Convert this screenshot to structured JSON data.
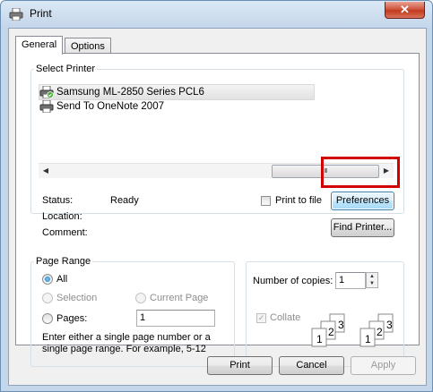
{
  "window": {
    "title": "Print",
    "close_glyph": "✕",
    "icon": "printer-icon"
  },
  "tabs": [
    {
      "label": "General",
      "active": true
    },
    {
      "label": "Options",
      "active": false
    }
  ],
  "select_printer": {
    "group_label": "Select Printer",
    "printers": [
      {
        "name": "Samsung ML-2850 Series PCL6",
        "selected": true,
        "default": true
      },
      {
        "name": "Send To OneNote 2007",
        "selected": false
      }
    ],
    "scroll": {
      "left_arrow": "◀",
      "right_arrow": "▶",
      "thumb_grip": "III"
    },
    "status_label": "Status:",
    "status_value": "Ready",
    "location_label": "Location:",
    "comment_label": "Comment:",
    "print_to_file_label": "Print to file",
    "preferences_label": "Preferences",
    "find_printer_label": "Find Printer..."
  },
  "page_range": {
    "group_label": "Page Range",
    "all_label": "All",
    "selection_label": "Selection",
    "current_page_label": "Current Page",
    "pages_label": "Pages:",
    "pages_value": "1",
    "hint": "Enter either a single page number or a single page range.  For example, 5-12"
  },
  "copies": {
    "number_label": "Number of copies:",
    "number_value": "1",
    "collate_label": "Collate",
    "collate_checked": true,
    "collate_pages": [
      "1",
      "2",
      "3"
    ]
  },
  "footer": {
    "print_label": "Print",
    "cancel_label": "Cancel",
    "apply_label": "Apply"
  },
  "colors": {
    "highlight": "#d20000",
    "title_bar": "#c4d6ea",
    "close_button": "#c23a1d"
  }
}
